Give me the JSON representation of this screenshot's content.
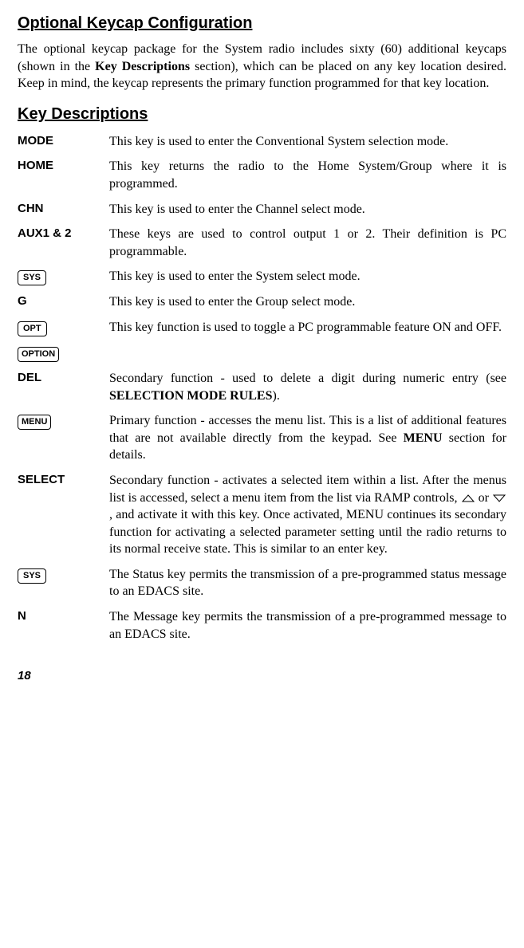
{
  "h1": "Optional Keycap Configuration",
  "intro_a": "The optional keycap package for the System radio includes sixty (60) additional keycaps (shown in the ",
  "intro_bold": "Key Descriptions",
  "intro_b": " section), which can be placed on any key location desired.  Keep in mind, the keycap represents the primary function programmed for that key location.",
  "h2": "Key Descriptions",
  "rows": {
    "mode": {
      "label": "MODE",
      "desc": "This key is used to enter the Conventional System selection mode."
    },
    "home": {
      "label": "HOME",
      "desc": "This key returns the radio to the Home System/Group where it is programmed."
    },
    "chn": {
      "label": "CHN",
      "desc": "This key is used to enter the Channel select mode."
    },
    "aux": {
      "label": "AUX1 & 2",
      "desc": "These keys are used to control output 1 or 2. Their definition is PC programmable."
    },
    "sys1": {
      "key": "SYS",
      "desc": "This key is used to enter the System select mode."
    },
    "g": {
      "label": "G",
      "desc": "This key is used to enter the Group select mode."
    },
    "opt": {
      "key": "OPT",
      "desc": "This key function is used to toggle a PC programmable feature ON and OFF."
    },
    "option": {
      "key": "OPTION"
    },
    "del": {
      "label": "DEL",
      "desc_a": "Secondary function - used to delete a digit during numeric entry (see ",
      "desc_bold": "SELECTION MODE RULES",
      "desc_b": ")."
    },
    "menu": {
      "key": "MENU",
      "desc_a": "Primary function - accesses the menu list.  This is a list of additional features that are not available directly from the keypad.  See ",
      "desc_bold": "MENU",
      "desc_b": " section for details."
    },
    "select": {
      "label": "SELECT",
      "desc_a": "Secondary function - activates a selected item within a list. After the menus list is accessed, select a menu item from the list via RAMP controls, ",
      "desc_or": " or ",
      "desc_b": ", and activate it with this key.  Once activated, MENU continues its secondary function for activating a selected parameter setting until the radio returns to its normal receive state.  This is similar to an enter key."
    },
    "sys2": {
      "key": "SYS",
      "desc": "The Status key permits the transmission of a pre-programmed status message to an EDACS site."
    },
    "n": {
      "label": "N",
      "desc": "The Message key permits the transmission of a pre-programmed message to an EDACS site."
    }
  },
  "page": "18"
}
